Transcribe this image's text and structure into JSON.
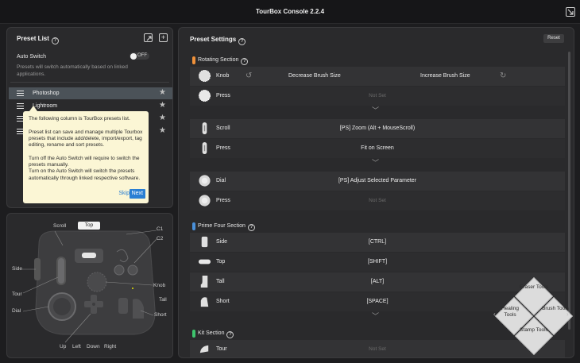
{
  "app": {
    "title": "TourBox Console 2.2.4"
  },
  "preset_list": {
    "title": "Preset List",
    "auto_switch_label": "Auto Switch",
    "auto_switch_state": "OFF",
    "auto_switch_desc": "Presets will switch automatically based on linked applications.",
    "items": [
      {
        "label": "Photoshop"
      },
      {
        "label": "Lightroom"
      },
      {
        "label": ""
      },
      {
        "label": ""
      }
    ]
  },
  "tooltip": {
    "p1": "The following column is TourBox presets list.",
    "p2": "Preset list can save and manage multiple Tourbox presets that include add/delete, import/export, tag editing, rename and sort presets.",
    "p3": "Turn off the Auto Switch will require to switch the presets manually.",
    "p4": "Turn on the Auto Switch will switch the presets automatically through linked respective software.",
    "skip": "Skip",
    "next": "Next"
  },
  "device": {
    "top_button": "Top",
    "labels": {
      "scroll": "Scroll",
      "c1": "C1",
      "c2": "C2",
      "side": "Side",
      "knob": "Knob",
      "tour": "Tour",
      "tall": "Tall",
      "dial": "Dial",
      "short": "Short",
      "up": "Up",
      "left": "Left",
      "down": "Down",
      "right": "Right"
    }
  },
  "preset_settings": {
    "title": "Preset Settings",
    "reset": "Reset",
    "rotating": {
      "title": "Rotating Section",
      "color": "#f0913a",
      "knob": {
        "name": "Knob",
        "left": "Decrease Brush Size",
        "right": "Increase Brush Size"
      },
      "knob_press": {
        "name": "Press",
        "value": "Not Set"
      },
      "scroll": {
        "name": "Scroll",
        "value": "[PS] Zoom (Alt + MouseScroll)"
      },
      "scroll_press": {
        "name": "Press",
        "value": "Fit on Screen"
      },
      "dial": {
        "name": "Dial",
        "value": "[PS] Adjust Selected Parameter"
      },
      "dial_press": {
        "name": "Press",
        "value": "Not Set"
      }
    },
    "prime_four": {
      "title": "Prime Four Section",
      "color": "#4a90d9",
      "rows": [
        {
          "name": "Side",
          "value": "[CTRL]"
        },
        {
          "name": "Top",
          "value": "[SHIFT]"
        },
        {
          "name": "Tall",
          "value": "[ALT]"
        },
        {
          "name": "Short",
          "value": "[SPACE]"
        }
      ]
    },
    "kit": {
      "title": "Kit Section",
      "color": "#3ec46d",
      "tour": {
        "name": "Tour",
        "value": "Not Set"
      }
    },
    "dpad_widget": {
      "up": "Eraser Tools",
      "left": "Healing Tools",
      "right": "Brush Tools",
      "down": "Stamp Tools"
    }
  }
}
